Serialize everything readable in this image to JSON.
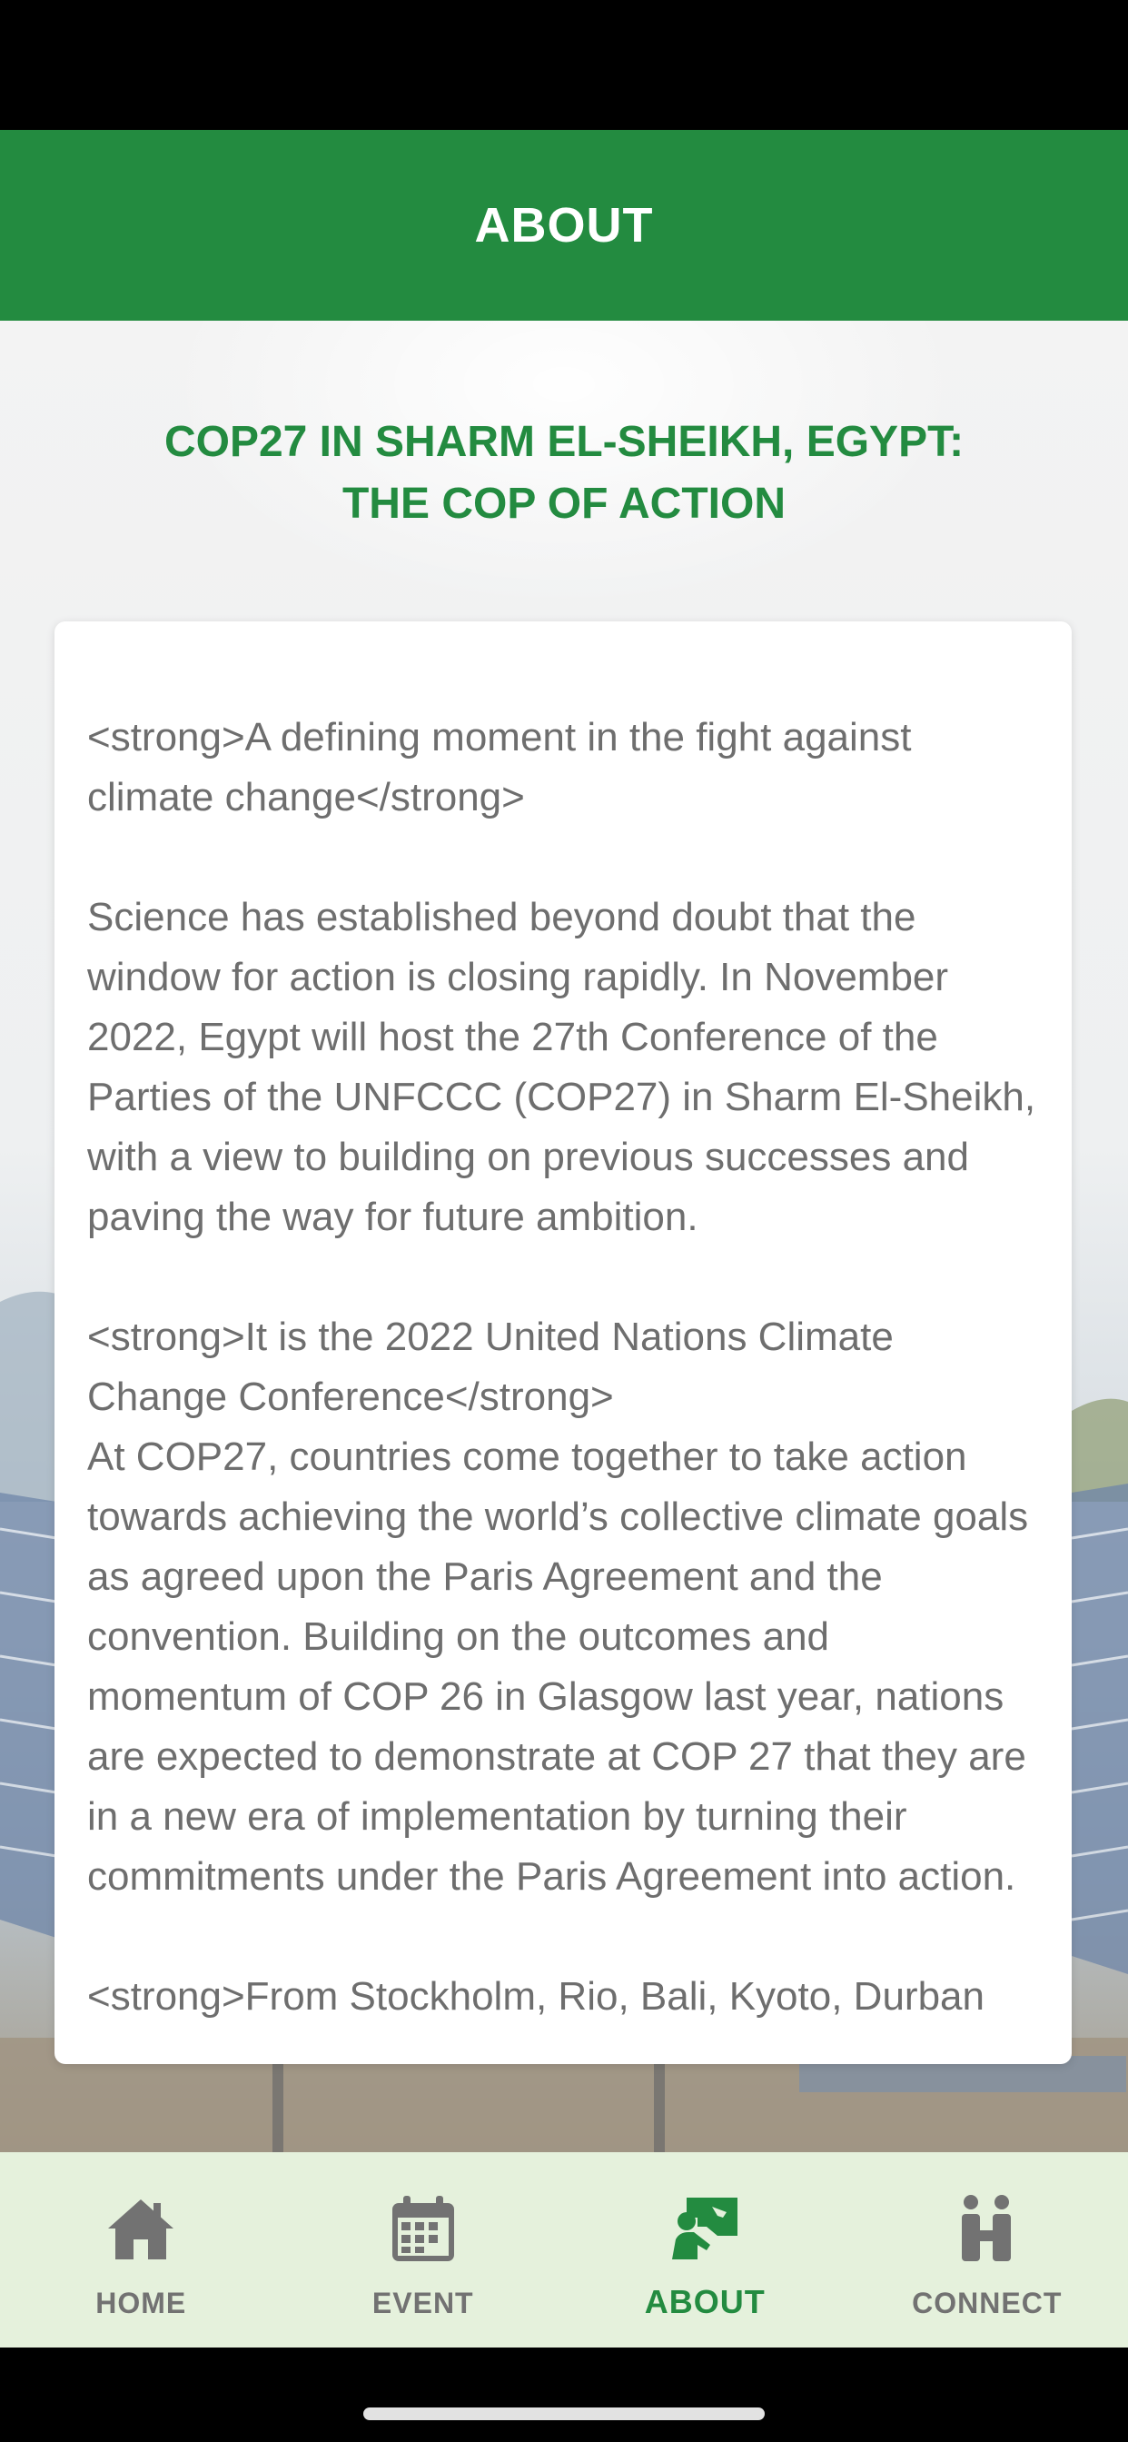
{
  "header": {
    "title": "ABOUT"
  },
  "page": {
    "title_line1": "COP27 IN SHARM EL-SHEIKH, EGYPT:",
    "title_line2": "THE COP OF ACTION"
  },
  "article": {
    "paragraph1": "<strong>A defining moment in the fight against climate change</strong>",
    "paragraph2": "Science has established beyond doubt that the window for action is closing rapidly. In November 2022, Egypt will host the 27th Conference of the Parties of the UNFCCC (COP27) in Sharm El-Sheikh, with a view to building on previous successes and paving the way for future ambition.",
    "paragraph3_heading": "<strong>It is the 2022 United Nations Climate Change Conference</strong>",
    "paragraph3_body": "At COP27, countries come together to take action towards achieving the world’s collective climate goals as agreed upon the Paris Agreement and the convention. Building on the outcomes and momentum of COP 26 in Glasgow last year, nations are expected to demonstrate at COP 27 that they are in a new era of implementation by turning their commitments under the Paris Agreement into action.",
    "paragraph4": "<strong>From Stockholm, Rio, Bali, Kyoto, Durban"
  },
  "tabs": [
    {
      "label": "HOME",
      "icon": "home-icon",
      "active": false
    },
    {
      "label": "EVENT",
      "icon": "calendar-icon",
      "active": false
    },
    {
      "label": "ABOUT",
      "icon": "about-icon",
      "active": true
    },
    {
      "label": "CONNECT",
      "icon": "connect-icon",
      "active": false
    }
  ],
  "colors": {
    "brand_green": "#238b40",
    "tab_bar_bg": "#e5f1dc",
    "inactive_tab": "#727272",
    "body_text": "#6e6e6e"
  }
}
